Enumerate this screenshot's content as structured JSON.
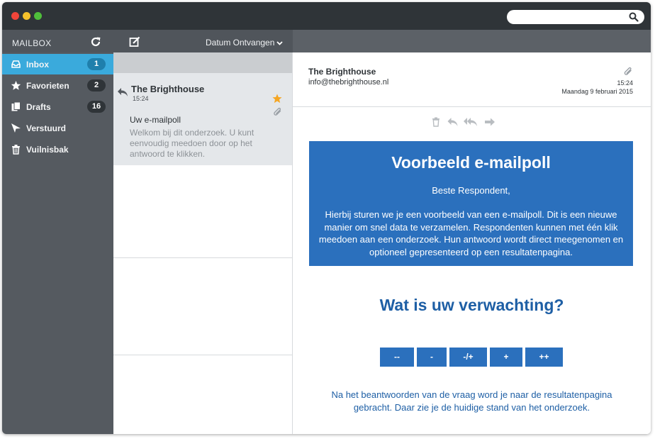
{
  "window": {
    "search_placeholder": ""
  },
  "sidebar": {
    "title": "MAILBOX",
    "items": [
      {
        "label": "Inbox",
        "count": "1"
      },
      {
        "label": "Favorieten",
        "count": "2"
      },
      {
        "label": "Drafts",
        "count": "16"
      },
      {
        "label": "Verstuurd",
        "count": ""
      },
      {
        "label": "Vuilnisbak",
        "count": ""
      }
    ]
  },
  "list": {
    "sort_label": "Datum Ontvangen",
    "message": {
      "from": "The Brighthouse",
      "time": "15:24",
      "subject": "Uw e-mailpoll",
      "preview": "Welkom bij dit onderzoek. U kunt eenvoudig meedoen door op het antwoord te klikken."
    }
  },
  "reader": {
    "from": "The Brighthouse",
    "email": "info@thebrighthouse.nl",
    "time": "15:24",
    "date": "Maandag 9 februari 2015",
    "banner_title": "Voorbeeld e-mailpoll",
    "greeting": "Beste Respondent,",
    "body": "Hierbij sturen we je een voorbeeld van een e-mailpoll. Dit is een nieuwe manier om snel data te verzamelen. Respondenten kunnen met één klik meedoen aan een onderzoek. Hun antwoord wordt direct meegenomen en optioneel gepresenteerd op een resultatenpagina.",
    "question": "Wat is uw verwachting?",
    "options": [
      "--",
      "-",
      "-/+",
      "+",
      "++"
    ],
    "footer": "Na het beantwoorden van de vraag word je naar de resultatenpagina gebracht. Daar zie je de huidige stand van het onderzoek."
  },
  "colors": {
    "accent": "#3aaadc",
    "titlebar": "#2f3438",
    "sidebar": "#555a60",
    "poll_blue": "#2b70bd",
    "star": "#f5a623"
  }
}
